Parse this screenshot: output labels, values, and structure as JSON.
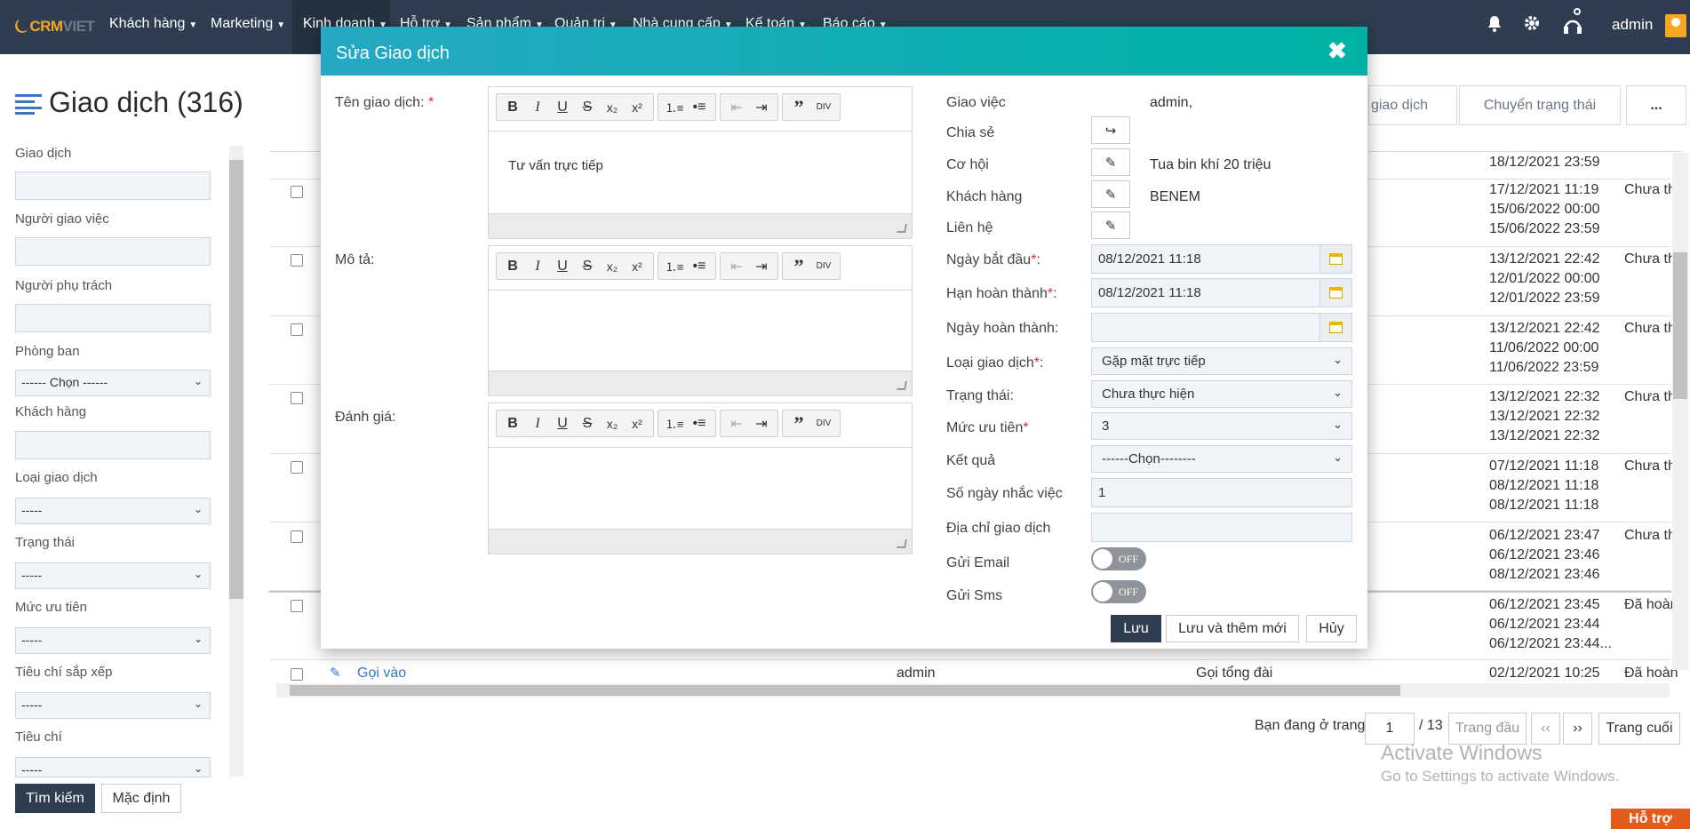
{
  "nav": {
    "logo_main": "CRM",
    "logo_sub": "VIET",
    "items": [
      "Khách hàng",
      "Marketing",
      "Kinh doanh",
      "Hỗ trợ",
      "Sản phẩm",
      "Quản trị",
      "Nhà cung cấp",
      "Kế toán",
      "Báo cáo"
    ],
    "user": "admin"
  },
  "page": {
    "title": "Giao dịch (316)",
    "buttons": [
      "giao dịch",
      "Chuyển trạng thái",
      "..."
    ]
  },
  "filters": {
    "fields": [
      "Giao dịch",
      "Người giao việc",
      "Người phụ trách",
      "Phòng ban",
      "Khách hàng",
      "Loại giao dịch",
      "Trạng thái",
      "Mức ưu tiên",
      "Tiêu chí sắp xếp",
      "Tiêu chí"
    ],
    "phong_ban_value": "------ Chọn ------",
    "default_select": "-----",
    "search_button": "Tìm kiếm",
    "reset_button": "Mặc định"
  },
  "table": {
    "rows": [
      {
        "dates": [
          "18/12/2021 23:59"
        ],
        "status": ""
      },
      {
        "dates": [
          "17/12/2021 11:19",
          "15/06/2022 00:00",
          "15/06/2022 23:59"
        ],
        "status": "Chưa th"
      },
      {
        "dates": [
          "13/12/2021 22:42",
          "12/01/2022 00:00",
          "12/01/2022 23:59"
        ],
        "status": "Chưa th"
      },
      {
        "dates": [
          "13/12/2021 22:42",
          "11/06/2022 00:00",
          "11/06/2022 23:59"
        ],
        "status": "Chưa th"
      },
      {
        "dates": [
          "13/12/2021 22:32",
          "13/12/2021 22:32",
          "13/12/2021 22:32"
        ],
        "status": "Chưa th"
      },
      {
        "dates": [
          "07/12/2021 11:18",
          "08/12/2021 11:18",
          "08/12/2021 11:18"
        ],
        "status": "Chưa th"
      },
      {
        "dates": [
          "06/12/2021 23:47",
          "06/12/2021 23:46",
          "08/12/2021 23:46"
        ],
        "status": "Chưa th"
      },
      {
        "dates": [
          "06/12/2021 23:45",
          "06/12/2021 23:44",
          "06/12/2021 23:44..."
        ],
        "status": "Đã hoàn"
      },
      {
        "name": "Gọi vào",
        "assignee": "admin",
        "type": "Gọi tổng đài",
        "dates": [
          "02/12/2021 10:25"
        ],
        "status": "Đã hoàn"
      }
    ]
  },
  "pager": {
    "label": "Bạn đang ở trang",
    "page": "1",
    "total": "/ 13",
    "first": "Trang đầu",
    "prev": "‹‹",
    "next": "››",
    "last": "Trang cuối"
  },
  "watermark": {
    "line1": "Activate Windows",
    "line2": "Go to Settings to activate Windows."
  },
  "support": "Hỗ trợ",
  "modal": {
    "title": "Sửa Giao dịch",
    "name_label": "Tên giao dịch:",
    "name_value": "Tư vấn trực tiếp",
    "desc_label": "Mô tả:",
    "eval_label": "Đánh giá:",
    "right": {
      "giao_viec_label": "Giao việc",
      "giao_viec_value": "admin,",
      "chia_se_label": "Chia sẻ",
      "co_hoi_label": "Cơ hội",
      "co_hoi_value": "Tua bin khí 20 triệu",
      "khach_hang_label": "Khách hàng",
      "khach_hang_value": "BENEM",
      "lien_he_label": "Liên hệ",
      "ngay_bat_dau_label": "Ngày bắt đầu",
      "ngay_bat_dau_value": "08/12/2021 11:18",
      "han_hoan_thanh_label": "Hạn hoàn thành",
      "han_hoan_thanh_value": "08/12/2021 11:18",
      "ngay_hoan_thanh_label": "Ngày hoàn thành:",
      "loai_giao_dich_label": "Loại giao dịch",
      "loai_giao_dich_value": "Gặp mặt trực tiếp",
      "trang_thai_label": "Trạng thái:",
      "trang_thai_value": "Chưa thực hiện",
      "muc_uu_tien_label": "Mức ưu tiên",
      "muc_uu_tien_value": "3",
      "ket_qua_label": "Kết quả",
      "ket_qua_value": "------Chọn--------",
      "so_ngay_label": "Số ngày nhắc việc",
      "so_ngay_value": "1",
      "dia_chi_label": "Địa chỉ giao dịch",
      "gui_email_label": "Gửi Email",
      "gui_sms_label": "Gửi Sms",
      "toggle_off": "OFF"
    },
    "save": "Lưu",
    "save_new": "Lưu và thêm mới",
    "cancel": "Hủy"
  }
}
